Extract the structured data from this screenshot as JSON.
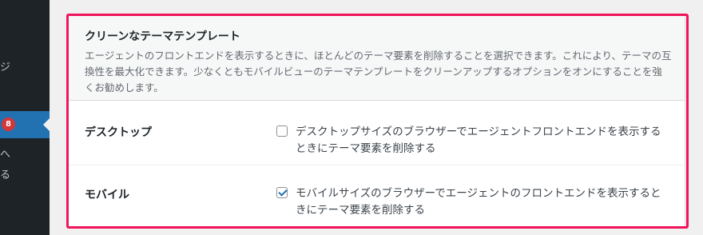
{
  "sidebar": {
    "fragments": [
      "ジ",
      "へ",
      "る"
    ],
    "active_badge": "8"
  },
  "settings": {
    "title": "クリーンなテーマテンプレート",
    "description": "エージェントのフロントエンドを表示するときに、ほとんどのテーマ要素を削除することを選択できます。これにより、テーマの互換性を最大化できます。少なくともモバイルビューのテーマテンプレートをクリーンアップするオプションをオンにすることを強くお勧めします。",
    "rows": [
      {
        "label": "デスクトップ",
        "checked": false,
        "text": "デスクトップサイズのブラウザーでエージェントフロントエンドを表示するときにテーマ要素を削除する"
      },
      {
        "label": "モバイル",
        "checked": true,
        "text": "モバイルサイズのブラウザーでエージェントのフロントエンドを表示するときにテーマ要素を削除する"
      }
    ]
  },
  "colors": {
    "highlight": "#f0145a",
    "accent": "#2271b1",
    "badge": "#d63638"
  }
}
